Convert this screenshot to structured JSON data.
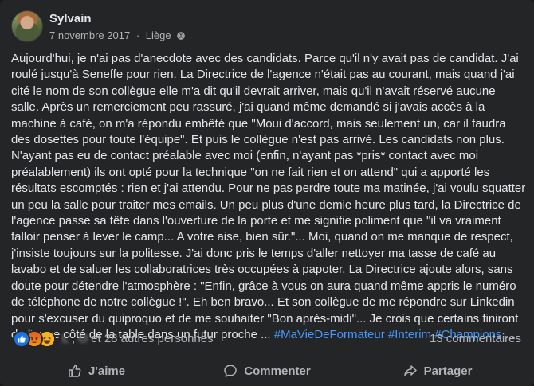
{
  "post": {
    "author": "Sylvain",
    "date": "7 novembre 2017",
    "separator": "·",
    "location": "Liège",
    "audience_icon": "globe-icon",
    "text": "Aujourd'hui, je n'ai pas d'anecdote avec des candidats. Parce qu'il n'y avait pas de candidat. J'ai roulé jusqu'à Seneffe pour rien. La Directrice de l'agence n'était pas au courant, mais quand j'ai cité le nom de son collègue elle m'a dit qu'il devrait arriver, mais qu'il n'avait réservé aucune salle. Après un remerciement peu rassuré, j'ai quand même demandé si j'avais accès à la machine à café, on m'a répondu embêté que \"Moui d'accord, mais seulement un, car il faudra des dosettes pour toute l'équipe\". Et puis le collègue n'est pas arrivé. Les candidats non plus. N'ayant pas eu de contact préalable avec moi (enfin, n'ayant pas *pris* contact avec moi préalablement) ils ont opté pour la technique \"on ne fait rien et on attend\" qui a apporté les résultats escomptés : rien et j'ai attendu. Pour ne pas perdre toute ma matinée, j'ai voulu squatter un peu la salle pour traiter mes emails. Un peu plus d'une demie heure plus tard, la Directrice de l'agence passe sa tête dans l'ouverture de la porte et me signifie poliment que \"il va vraiment falloir penser à lever le camp... A votre aise, bien sûr.\"... Moi, quand on me manque de respect, j'insiste toujours sur la politesse. J'ai donc pris le temps d'aller nettoyer ma tasse de café au lavabo et de saluer les collaboratrices très occupées à papoter. La Directrice ajoute alors, sans doute pour détendre l'atmosphère : \"Enfin, grâce à vous on aura quand même appris le numéro de téléphone de notre collègue !\". Eh ben bravo... Et son collègue de me répondre sur Linkedin pour s'excuser du quiproquo et de me souhaiter \"Bon après-midi\"... Je crois que certains finiront de l'autre côté de la table dans un futur proche ... ",
    "hashtags": "#MaVieDeFormateur #Interim #Champions",
    "ellipsis": " ..."
  },
  "reactions": {
    "icons": [
      "like-icon",
      "angry-icon",
      "haha-icon"
    ],
    "name1": "L",
    "name2": "O",
    "others": "et 28 autres personnes",
    "comments": "13 commentaires"
  },
  "actions": {
    "like": "J'aime",
    "comment": "Commenter",
    "share": "Partager"
  },
  "colors": {
    "background": "#242526",
    "text": "#e4e6eb",
    "secondary": "#b0b3b8",
    "link": "#4599ff"
  }
}
